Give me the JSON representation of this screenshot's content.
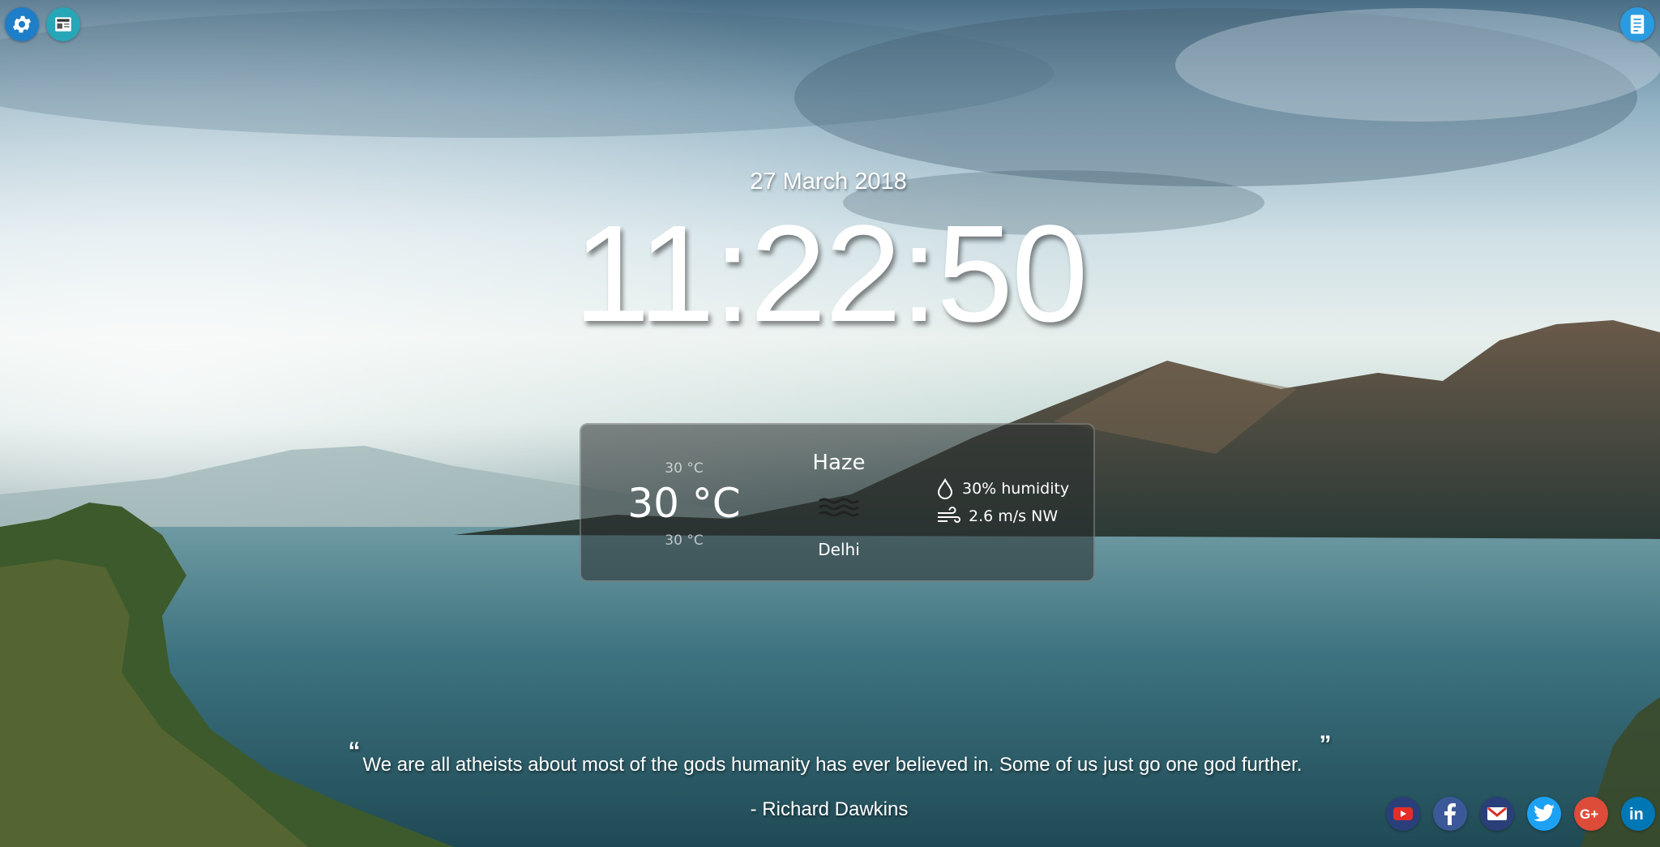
{
  "header": {
    "settings_icon": "gear-icon",
    "news_icon": "newspaper-icon",
    "notes_icon": "notepad-icon"
  },
  "clock": {
    "date": "27 March 2018",
    "time": "11:22:50"
  },
  "weather": {
    "temp_max": "30 °C",
    "temperature": "30 °C",
    "temp_min": "30 °C",
    "condition": "Haze",
    "condition_icon": "haze-icon",
    "city": "Delhi",
    "humidity": "30% humidity",
    "wind": "2.6 m/s NW"
  },
  "quote": {
    "open_mark": "“",
    "close_mark": "”",
    "text": "We are all atheists about most of the gods humanity has ever believed in. Some of us just go one god further.",
    "author": "- Richard Dawkins"
  },
  "social": [
    {
      "name": "youtube",
      "icon": "youtube-icon",
      "color": "#2a3f7a"
    },
    {
      "name": "facebook",
      "icon": "facebook-icon",
      "color": "#3b5998"
    },
    {
      "name": "gmail",
      "icon": "mail-icon",
      "color": "#2a3f7a"
    },
    {
      "name": "twitter",
      "icon": "twitter-icon",
      "color": "#1da1f2"
    },
    {
      "name": "google-plus",
      "icon": "google-plus-icon",
      "color": "#dd4b39"
    },
    {
      "name": "linkedin",
      "icon": "linkedin-icon",
      "color": "#0077b5"
    }
  ],
  "colors": {
    "settings_bg": "#1e7ec8",
    "news_bg": "#27a6b8",
    "notes_bg": "#2b9be0"
  }
}
